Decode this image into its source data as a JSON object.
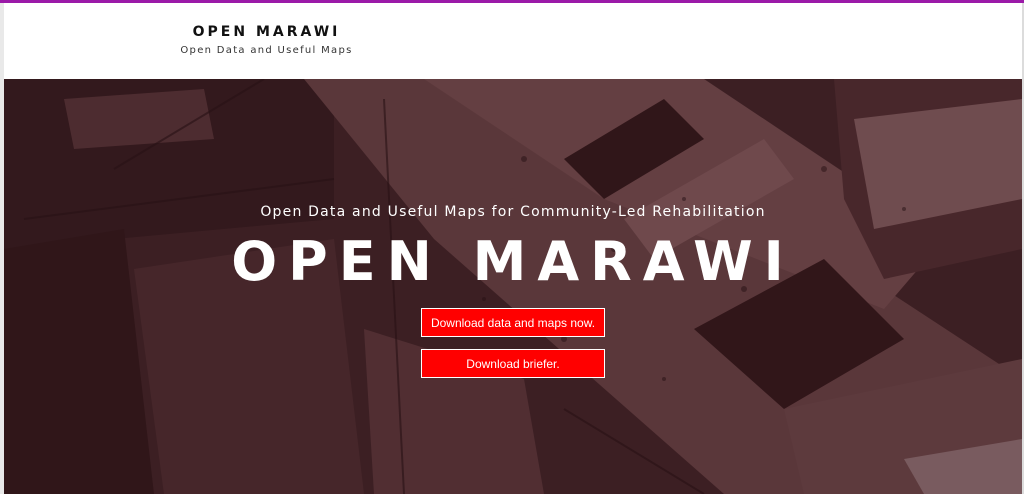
{
  "header": {
    "title": "OPEN MARAWI",
    "tagline": "Open Data and Useful Maps"
  },
  "hero": {
    "subtitle": "Open Data and Useful Maps for Community-Led Rehabilitation",
    "title": "OPEN MARAWI",
    "buttons": {
      "download_data": "Download data and maps now.",
      "download_briefer": "Download briefer."
    }
  },
  "colors": {
    "accent_bar": "#9b1aa8",
    "button": "#ff0000",
    "hero_tint": "#4a2d31"
  }
}
